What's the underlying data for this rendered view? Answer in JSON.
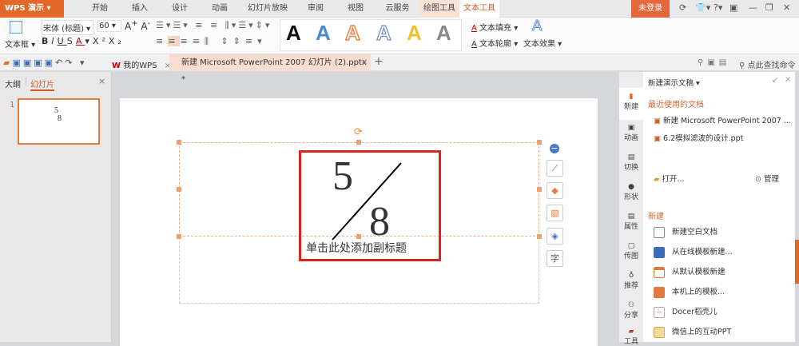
{
  "app": {
    "logo": "WPS 演示",
    "login": "未登录"
  },
  "menu_tabs": [
    "开始",
    "插入",
    "设计",
    "动画",
    "幻灯片放映",
    "审阅",
    "视图",
    "云服务",
    "绘图工具",
    "文本工具"
  ],
  "ribbon": {
    "textbox": "文本框",
    "font": "宋体 (标题)",
    "size": "60",
    "styles_letter": "A",
    "text_fill": "文本填充",
    "text_outline": "文本轮廓",
    "text_effect": "文本效果",
    "search": "点此查找命令"
  },
  "doc_tabs": {
    "my_wps": "我的WPS",
    "current": "新建 Microsoft PowerPoint 2007 幻灯片 (2).pptx *",
    "add": "+"
  },
  "left_panel": {
    "outline": "大纲",
    "slides": "幻灯片",
    "slide_number": "1"
  },
  "slide": {
    "numerator": "5",
    "denominator": "8",
    "subtitle_placeholder": "单击此处添加副标题"
  },
  "strip": [
    "新建",
    "动画",
    "切换",
    "形状",
    "属性",
    "传图",
    "推荐",
    "分享",
    "工具"
  ],
  "panel": {
    "title": "新建演示文稿",
    "recent_header": "最近使用的文档",
    "recent": [
      "新建 Microsoft PowerPoint 2007 ...",
      "6.2模拟滤波的设计.ppt"
    ],
    "open": "打开...",
    "manage": "管理",
    "new_header": "新建",
    "new_items": [
      "新建空白文档",
      "从在线模板新建...",
      "从默认模板新建",
      "本机上的模板...",
      "Docer稻壳儿",
      "微信上的互动PPT"
    ]
  },
  "colors": {
    "accent": "#e4672a",
    "red_box": "#d9261c"
  }
}
